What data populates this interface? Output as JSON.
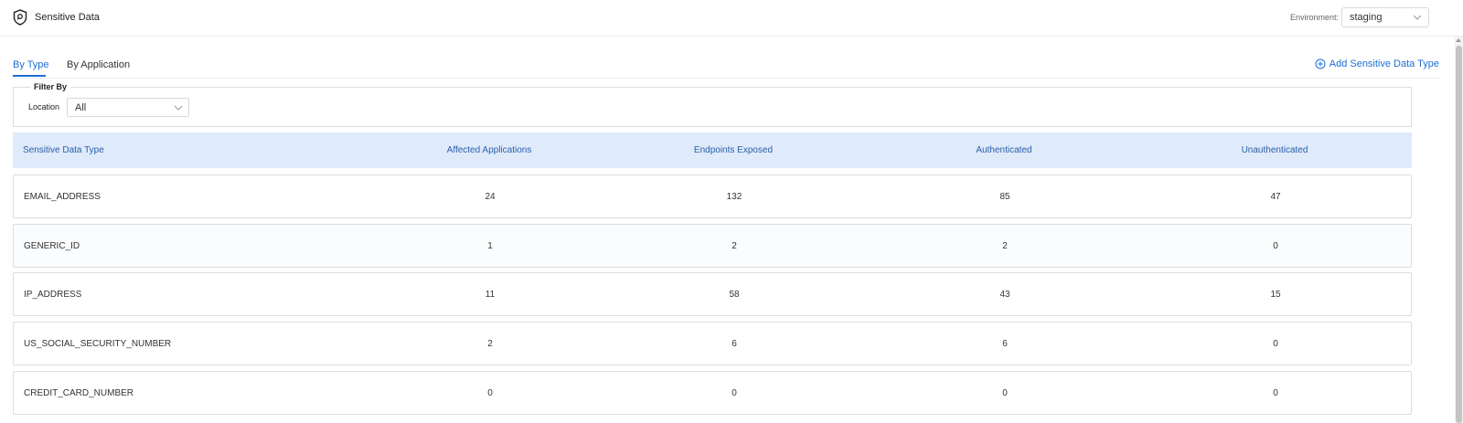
{
  "header": {
    "app_title": "Sensitive Data",
    "environment_label": "Environment:",
    "environment_value": "staging"
  },
  "tabs": [
    {
      "label": "By Type",
      "active": true
    },
    {
      "label": "By Application",
      "active": false
    }
  ],
  "actions": {
    "add_label": "Add Sensitive Data Type"
  },
  "filter": {
    "legend": "Filter By",
    "location_label": "Location",
    "location_value": "All"
  },
  "table": {
    "columns": [
      "Sensitive Data Type",
      "Affected Applications",
      "Endpoints Exposed",
      "Authenticated",
      "Unauthenticated"
    ],
    "rows": [
      [
        "EMAIL_ADDRESS",
        "24",
        "132",
        "85",
        "47"
      ],
      [
        "GENERIC_ID",
        "1",
        "2",
        "2",
        "0"
      ],
      [
        "IP_ADDRESS",
        "11",
        "58",
        "43",
        "15"
      ],
      [
        "US_SOCIAL_SECURITY_NUMBER",
        "2",
        "6",
        "6",
        "0"
      ],
      [
        "CREDIT_CARD_NUMBER",
        "0",
        "0",
        "0",
        "0"
      ]
    ]
  },
  "icons": {
    "brand": "shield-icon",
    "add": "plus-circle-icon",
    "dropdown": "chevron-down-icon"
  },
  "colors": {
    "accent": "#1c6fd6",
    "header_bg": "#dfeafb",
    "header_text": "#2a5fa8"
  }
}
